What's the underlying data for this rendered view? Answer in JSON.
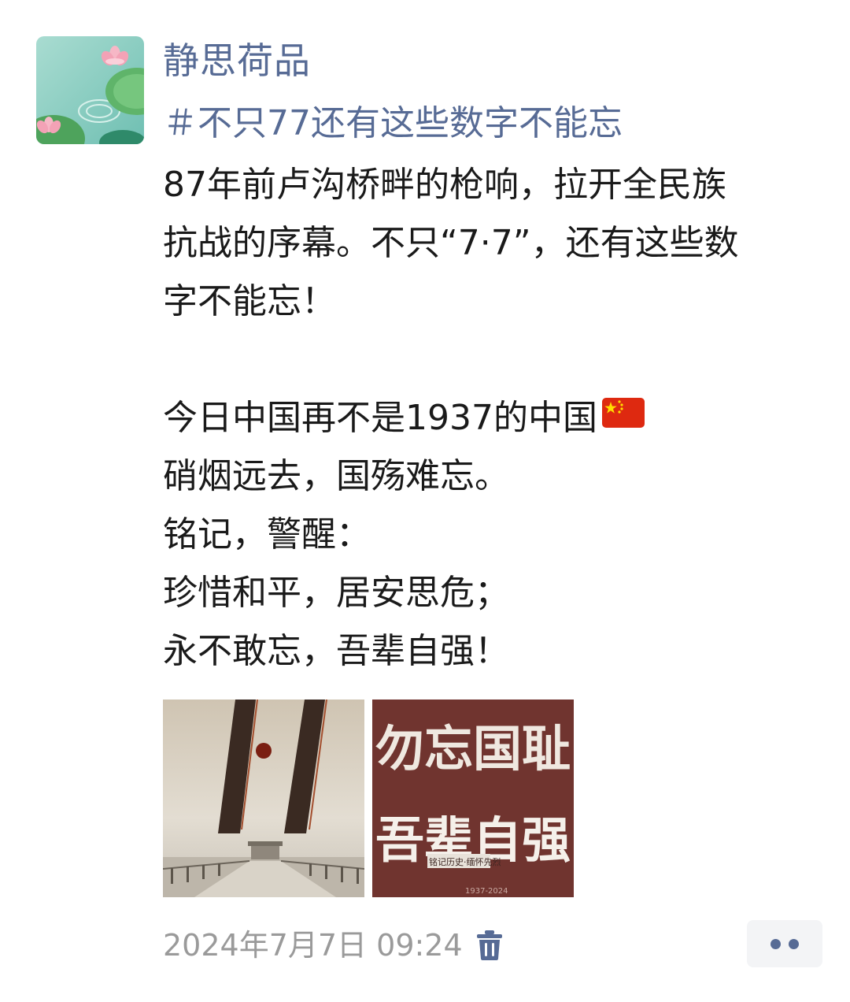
{
  "post": {
    "author": {
      "nickname": "静思荷品",
      "avatar_icon": "lotus-pond-avatar"
    },
    "topic": "＃不只77还有这些数字不能忘",
    "content_lines": [
      "87年前卢沟桥畔的枪响，拉开全民族",
      "抗战的序幕。不只“7·7”，还有这些数",
      "字不能忘！",
      "",
      "今日中国再不是1937的中国",
      "硝烟远去，国殇难忘。",
      "铭记，警醒：",
      "珍惜和平，居安思危；",
      "永不敢忘，吾辈自强！"
    ],
    "emoji": "china-flag-icon",
    "images": [
      {
        "name": "77-poster-image",
        "description_icon": "marco-polo-bridge-poster"
      },
      {
        "name": "wuwang-guochi-poster-image",
        "headline_top": "勿忘国耻",
        "headline_bottom": "吾辈自强",
        "caption": "铭记历史·缅怀先烈",
        "years": "1937-2024"
      }
    ],
    "timestamp": "2024年7月7日 09:24",
    "delete_icon": "trash-icon",
    "more_icon": "more-dots-icon"
  },
  "colors": {
    "link": "#576b95",
    "text": "#1a1a1a",
    "meta": "#9a9a9a",
    "more_bg": "#f3f4f6"
  }
}
